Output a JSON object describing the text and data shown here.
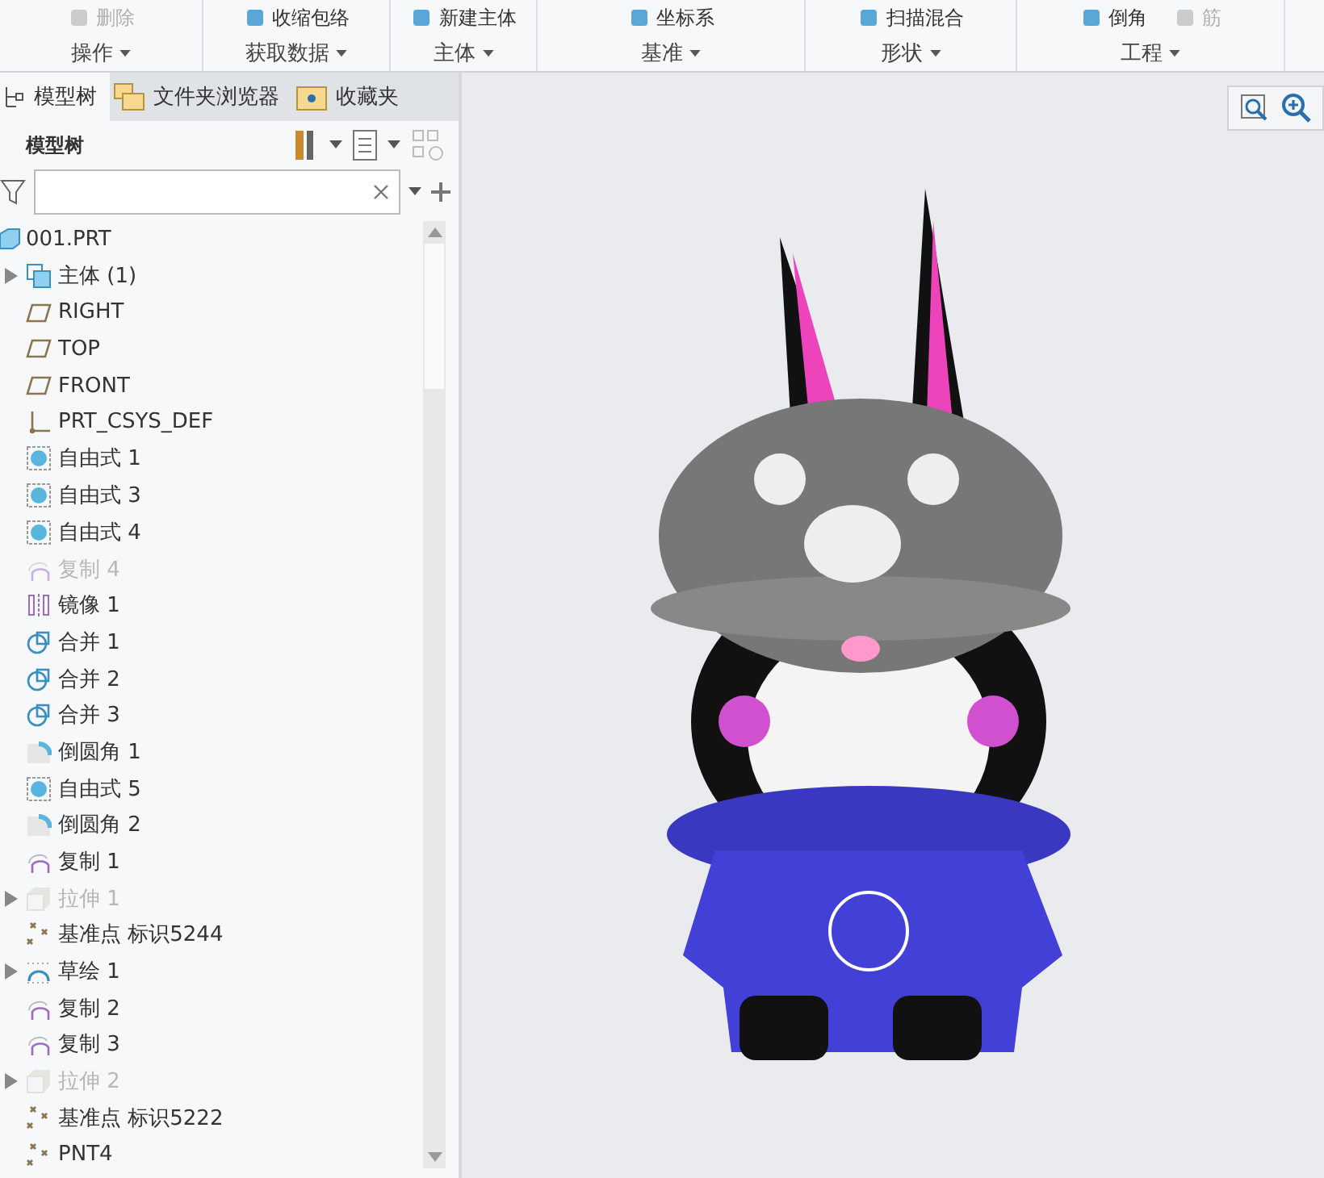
{
  "ribbon": {
    "groups": [
      {
        "label": "操作",
        "buttons": [
          {
            "label": "删除",
            "disabled": true
          }
        ]
      },
      {
        "label": "获取数据",
        "buttons": [
          {
            "label": "收缩包络",
            "disabled": false
          }
        ]
      },
      {
        "label": "主体",
        "buttons": [
          {
            "label": "新建主体",
            "disabled": false
          }
        ]
      },
      {
        "label": "基准",
        "buttons": [
          {
            "label": "坐标系",
            "disabled": false
          }
        ]
      },
      {
        "label": "形状",
        "buttons": [
          {
            "label": "扫描混合",
            "disabled": false
          }
        ]
      },
      {
        "label": "工程",
        "buttons": [
          {
            "label": "倒角",
            "disabled": false
          },
          {
            "label": "筋",
            "disabled": true
          }
        ]
      }
    ]
  },
  "tabs": [
    {
      "label": "模型树",
      "selected": true
    },
    {
      "label": "文件夹浏览器",
      "selected": false
    },
    {
      "label": "收藏夹",
      "selected": false
    }
  ],
  "panel": {
    "title": "模型树"
  },
  "tree": [
    {
      "label": "001.PRT",
      "kind": "part",
      "disabled": false,
      "expandable": false
    },
    {
      "label": "主体 (1)",
      "kind": "body",
      "disabled": false,
      "expandable": true
    },
    {
      "label": "RIGHT",
      "kind": "plane",
      "disabled": false,
      "expandable": false
    },
    {
      "label": "TOP",
      "kind": "plane",
      "disabled": false,
      "expandable": false
    },
    {
      "label": "FRONT",
      "kind": "plane",
      "disabled": false,
      "expandable": false
    },
    {
      "label": "PRT_CSYS_DEF",
      "kind": "csys",
      "disabled": false,
      "expandable": false
    },
    {
      "label": "自由式 1",
      "kind": "freeform",
      "disabled": false,
      "expandable": false
    },
    {
      "label": "自由式 3",
      "kind": "freeform",
      "disabled": false,
      "expandable": false
    },
    {
      "label": "自由式 4",
      "kind": "freeform",
      "disabled": false,
      "expandable": false
    },
    {
      "label": "复制 4",
      "kind": "copy",
      "disabled": true,
      "expandable": false
    },
    {
      "label": "镜像 1",
      "kind": "mirror",
      "disabled": false,
      "expandable": false
    },
    {
      "label": "合并 1",
      "kind": "merge",
      "disabled": false,
      "expandable": false
    },
    {
      "label": "合并 2",
      "kind": "merge",
      "disabled": false,
      "expandable": false
    },
    {
      "label": "合并 3",
      "kind": "merge",
      "disabled": false,
      "expandable": false
    },
    {
      "label": "倒圆角 1",
      "kind": "round",
      "disabled": false,
      "expandable": false
    },
    {
      "label": "自由式 5",
      "kind": "freeform",
      "disabled": false,
      "expandable": false
    },
    {
      "label": "倒圆角 2",
      "kind": "round",
      "disabled": false,
      "expandable": false
    },
    {
      "label": "复制 1",
      "kind": "copy",
      "disabled": false,
      "expandable": false
    },
    {
      "label": "拉伸 1",
      "kind": "extrude",
      "disabled": true,
      "expandable": true
    },
    {
      "label": "基准点 标识5244",
      "kind": "point",
      "disabled": false,
      "expandable": false
    },
    {
      "label": "草绘 1",
      "kind": "sketch",
      "disabled": false,
      "expandable": true
    },
    {
      "label": "复制 2",
      "kind": "copy",
      "disabled": false,
      "expandable": false
    },
    {
      "label": "复制 3",
      "kind": "copy",
      "disabled": false,
      "expandable": false
    },
    {
      "label": "拉伸 2",
      "kind": "extrude",
      "disabled": true,
      "expandable": true
    },
    {
      "label": "基准点 标识5222",
      "kind": "point",
      "disabled": false,
      "expandable": false
    },
    {
      "label": "PNT4",
      "kind": "point",
      "disabled": false,
      "expandable": false
    }
  ]
}
